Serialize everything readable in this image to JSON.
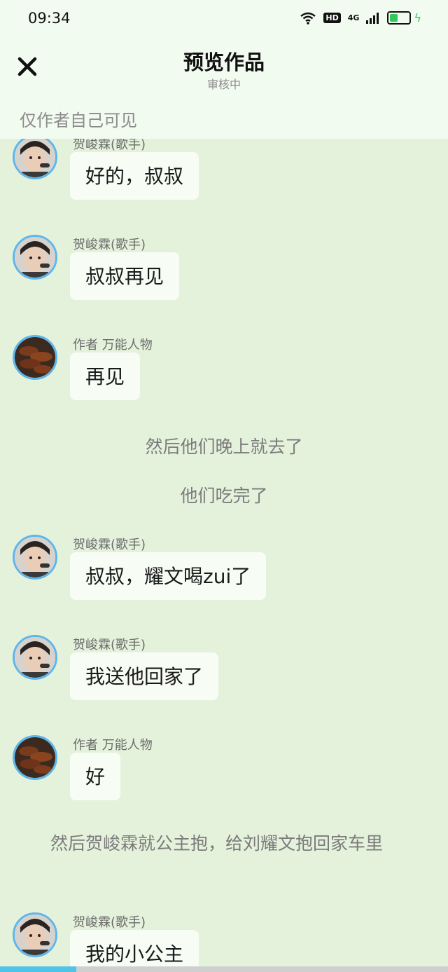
{
  "status_bar": {
    "time": "09:34",
    "hd": "HD",
    "network": "4G",
    "battery_level": 0.5
  },
  "header": {
    "title": "预览作品",
    "subtitle": "审核中",
    "visibility": "仅作者自己可见"
  },
  "messages": [
    {
      "sender": "贺峻霖(歌手)",
      "text": "好的，叔叔",
      "avatar": "singer-avatar"
    },
    {
      "sender": "贺峻霖(歌手)",
      "text": "叔叔再见",
      "avatar": "singer-avatar"
    },
    {
      "sender": "作者 万能人物",
      "text": "再见",
      "avatar": "food-avatar"
    },
    {
      "narration": "然后他们晚上就去了"
    },
    {
      "narration": "他们吃完了"
    },
    {
      "sender": "贺峻霖(歌手)",
      "text": "叔叔，耀文喝zui了",
      "avatar": "singer-avatar"
    },
    {
      "sender": "贺峻霖(歌手)",
      "text": "我送他回家了",
      "avatar": "singer-avatar"
    },
    {
      "sender": "作者 万能人物",
      "text": "好",
      "avatar": "food-avatar"
    },
    {
      "narration": "然后贺峻霖就公主抱，给刘耀文抱回家车里"
    },
    {
      "sender": "贺峻霖(歌手)",
      "text": "我的小公主",
      "avatar": "singer-avatar"
    }
  ],
  "progress": 0.17,
  "colors": {
    "background": "#e4f2dc",
    "header": "#f2fbef",
    "bubble": "#f7fcf5",
    "avatar_border": "#5eb6ea",
    "progress": "#4fc3e8"
  }
}
